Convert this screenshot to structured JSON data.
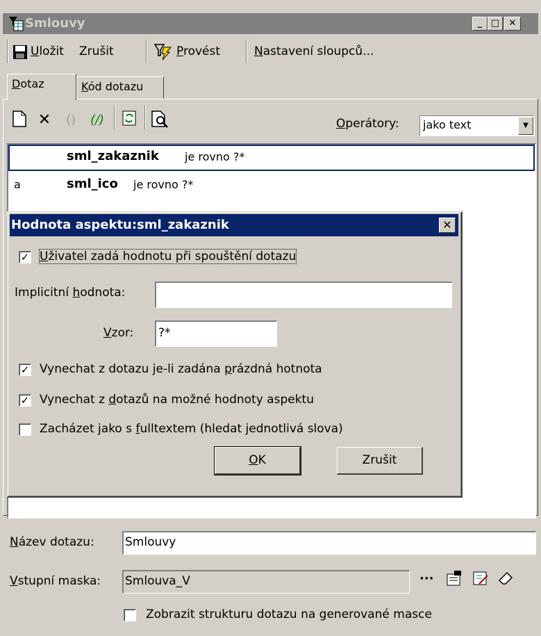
{
  "window": {
    "title": "Smlouvy"
  },
  "toolbar": {
    "save_label": "Uložit",
    "save_key": "U",
    "save_rest": "ložit",
    "cancel_label": "Zrušit",
    "run_key": "P",
    "run_rest": "rovést",
    "columns_key": "N",
    "columns_rest": "astavení sloupců..."
  },
  "tabs": [
    {
      "key": "D",
      "rest": "otaz"
    },
    {
      "key": "K",
      "rest": "ód dotazu"
    }
  ],
  "query_toolbar": {
    "operators_key": "O",
    "operators_rest": "perátory:",
    "operators_value": "jako text"
  },
  "query_rows": [
    {
      "conj": "",
      "field": "sml_zakaznik",
      "op": "je rovno  ?*"
    },
    {
      "conj": "a",
      "field": "sml_ico",
      "op": "je rovno  ?*"
    }
  ],
  "dialog": {
    "title": "Hodnota aspektu:sml_zakaznik",
    "user_enters": {
      "key": "U",
      "rest": "živatel zadá hodnotu při spouštění dotazu",
      "checked": true
    },
    "default_label_pre": "Implicitní ",
    "default_key": "h",
    "default_label_post": "odnota:",
    "default_value": "",
    "pattern_key": "V",
    "pattern_rest": "zor:",
    "pattern_value": "?*",
    "omit_empty": {
      "pre": "Vynechat z dotazu je-li zadána ",
      "key": "p",
      "post": "rázdná hotnota",
      "checked": true
    },
    "omit_values": {
      "pre": "Vynechat z ",
      "key": "d",
      "post": "otazů na možné hodnoty aspektu",
      "checked": true
    },
    "fulltext": {
      "pre": "Zacházet jako s ",
      "key": "f",
      "post": "ulltextem (hledat jednotlivá slova)",
      "checked": false
    },
    "ok_key": "O",
    "ok_rest": "K",
    "cancel_label": "Zrušit"
  },
  "bottom": {
    "name_key": "N",
    "name_rest": "ázev dotazu:",
    "name_value": "Smlouvy",
    "mask_key": "V",
    "mask_rest": "stupní maska:",
    "mask_value": "Smlouva_V",
    "ellipsis": "···",
    "show_structure": "Zobrazit strukturu dotazu na generované masce",
    "show_structure_checked": false
  }
}
